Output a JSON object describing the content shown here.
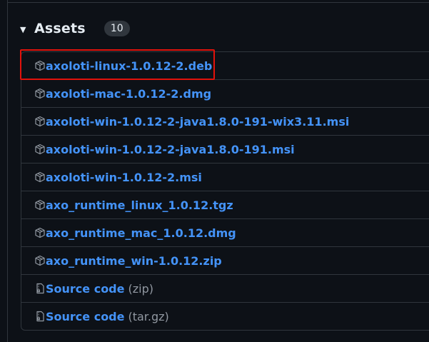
{
  "assets": {
    "title": "Assets",
    "count": "10",
    "caret": "▼",
    "items": [
      {
        "name": "axoloti-linux-1.0.12-2.deb",
        "suffix": "",
        "icon": "package-icon"
      },
      {
        "name": "axoloti-mac-1.0.12-2.dmg",
        "suffix": "",
        "icon": "package-icon"
      },
      {
        "name": "axoloti-win-1.0.12-2-java1.8.0-191-wix3.11.msi",
        "suffix": "",
        "icon": "package-icon"
      },
      {
        "name": "axoloti-win-1.0.12-2-java1.8.0-191.msi",
        "suffix": "",
        "icon": "package-icon"
      },
      {
        "name": "axoloti-win-1.0.12-2.msi",
        "suffix": "",
        "icon": "package-icon"
      },
      {
        "name": "axo_runtime_linux_1.0.12.tgz",
        "suffix": "",
        "icon": "package-icon"
      },
      {
        "name": "axo_runtime_mac_1.0.12.dmg",
        "suffix": "",
        "icon": "package-icon"
      },
      {
        "name": "axo_runtime_win-1.0.12.zip",
        "suffix": "",
        "icon": "package-icon"
      },
      {
        "name": "Source code",
        "suffix": "(zip)",
        "icon": "file-zip-icon"
      },
      {
        "name": "Source code",
        "suffix": "(tar.gz)",
        "icon": "file-zip-icon"
      }
    ]
  },
  "colors": {
    "background": "#0d1117",
    "link": "#4493f8",
    "highlight": "#e3120b"
  }
}
